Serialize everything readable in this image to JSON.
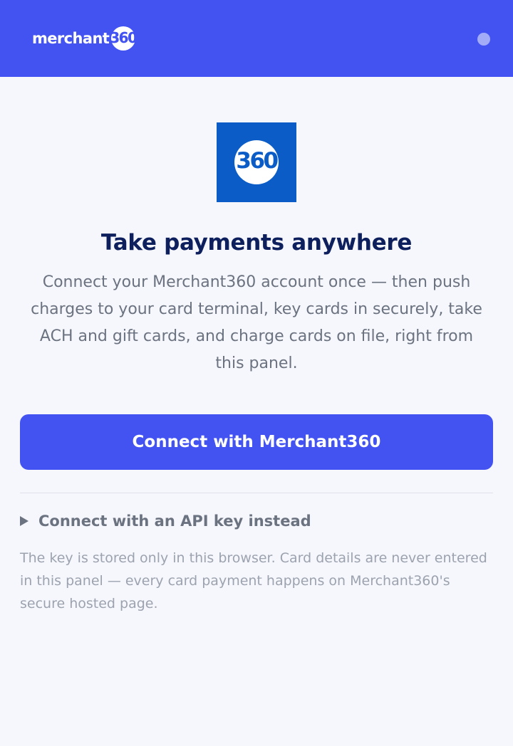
{
  "header": {
    "brand_word": "merchant",
    "brand_number": "360",
    "status_dot_color": "#a3acf7"
  },
  "logo": {
    "number": "360",
    "tile_color": "#0c5cc8"
  },
  "main": {
    "title": "Take payments anywhere",
    "description": "Connect your Merchant360 account once — then push charges to your card terminal, key cards in securely, take ACH and gift cards, and charge cards on file, right from this panel.",
    "connect_button_label": "Connect with Merchant360",
    "api_toggle_label": "Connect with an API key instead",
    "footnote": "The key is stored only in this browser. Card details are never entered in this panel — every card payment happens on Merchant360's secure hosted page."
  },
  "colors": {
    "accent": "#4353f2",
    "title": "#0d1f5c",
    "body_text": "#6b7280",
    "muted_text": "#9ca3af",
    "background": "#f6f7fc"
  },
  "icons": {
    "toggle": "caret-right-icon"
  }
}
